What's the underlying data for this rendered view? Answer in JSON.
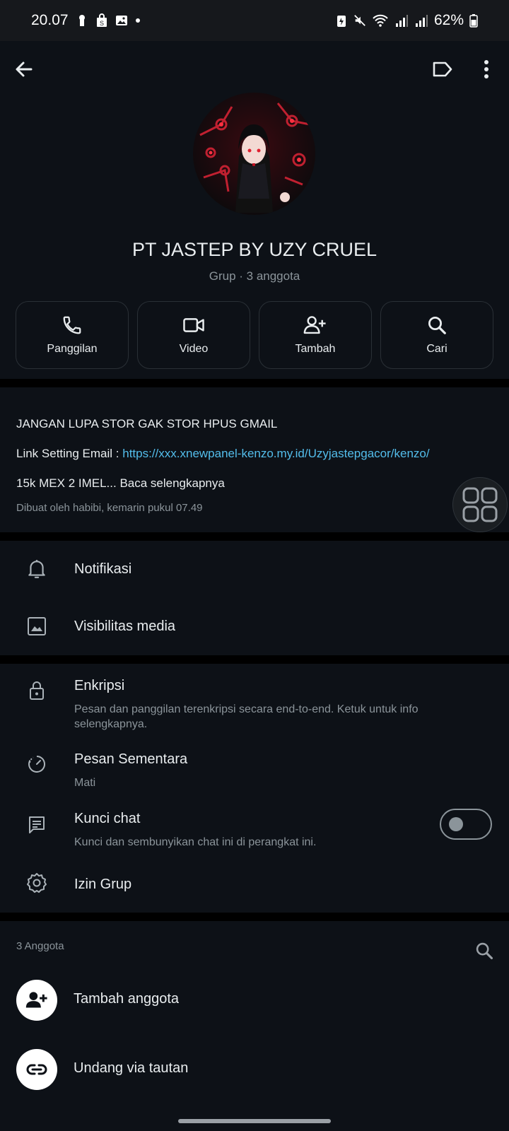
{
  "status": {
    "time": "20.07",
    "battery": "62%"
  },
  "group": {
    "name": "PT JASTEP BY UZY CRUEL",
    "subtitle": "Grup · 3 anggota"
  },
  "actions": [
    {
      "label": "Panggilan",
      "icon": "phone-icon"
    },
    {
      "label": "Video",
      "icon": "video-icon"
    },
    {
      "label": "Tambah",
      "icon": "add-person-icon"
    },
    {
      "label": "Cari",
      "icon": "search-icon"
    }
  ],
  "description": {
    "line1": "JANGAN LUPA STOR GAK STOR HPUS GMAIL",
    "link_label": "Link Setting Email : ",
    "link_url": "https://xxx.xnewpanel-kenzo.my.id/Uzyjastepgacor/kenzo/",
    "line3": "15k MEX 2 IMEL... Baca selengkapnya",
    "created": "Dibuat oleh habibi, kemarin pukul 07.49"
  },
  "settings1": [
    {
      "title": "Notifikasi",
      "icon": "bell-icon"
    },
    {
      "title": "Visibilitas media",
      "icon": "image-icon"
    }
  ],
  "settings2": {
    "encryption": {
      "title": "Enkripsi",
      "sub": "Pesan dan panggilan terenkripsi secara end-to-end. Ketuk untuk info selengkapnya."
    },
    "disappearing": {
      "title": "Pesan Sementara",
      "sub": "Mati"
    },
    "chat_lock": {
      "title": "Kunci chat",
      "sub": "Kunci dan sembunyikan chat ini di perangkat ini.",
      "enabled": false
    },
    "permissions": {
      "title": "Izin Grup"
    }
  },
  "members": {
    "count_label": "3 Anggota",
    "add_label": "Tambah anggota",
    "invite_label": "Undang via tautan"
  }
}
